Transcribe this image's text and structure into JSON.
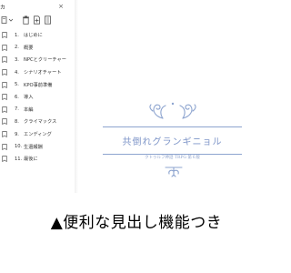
{
  "panel": {
    "title": "カ",
    "close_glyph": "×",
    "bookmarks": [
      {
        "num": "1.",
        "label": "はじめに"
      },
      {
        "num": "2.",
        "label": "概要"
      },
      {
        "num": "3.",
        "label": "NPCとクリーチャー"
      },
      {
        "num": "4.",
        "label": "シナリオチャート"
      },
      {
        "num": "5.",
        "label": "KPO事前準備"
      },
      {
        "num": "6.",
        "label": "導入"
      },
      {
        "num": "7.",
        "label": "本編"
      },
      {
        "num": "8.",
        "label": "クライマックス"
      },
      {
        "num": "9.",
        "label": "エンディング"
      },
      {
        "num": "10.",
        "label": "生還報酬"
      },
      {
        "num": "11.",
        "label": "最後に"
      }
    ]
  },
  "document": {
    "title": "共倒れグランギニョル",
    "subtitle": "クトゥルフ神話 TRPG 第６版",
    "accent_color": "#7e95c8"
  },
  "caption": "▲便利な見出し機能つき"
}
